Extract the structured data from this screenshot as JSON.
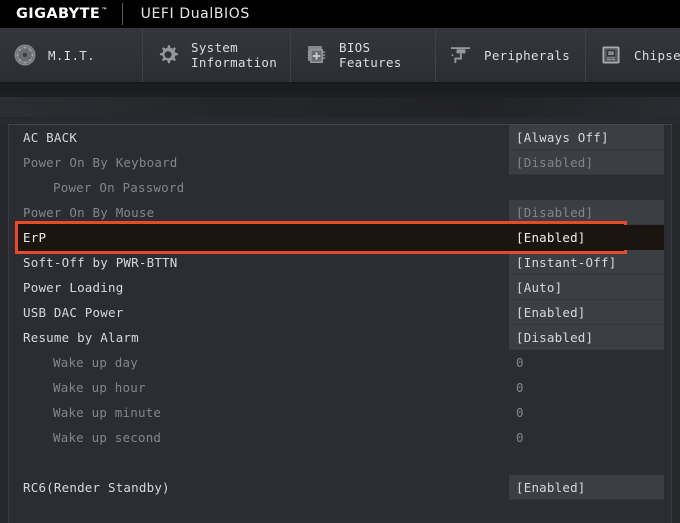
{
  "brand": {
    "logo": "GIGABYTE",
    "trademark": "™",
    "title": "UEFI DualBIOS"
  },
  "tabs": [
    {
      "label": "M.I.T.",
      "icon": "gauge-icon",
      "id": "mit"
    },
    {
      "label": "System\nInformation",
      "icon": "gear-icon",
      "id": "system-information"
    },
    {
      "label": "BIOS\nFeatures",
      "icon": "chip-plus-icon",
      "id": "bios-features"
    },
    {
      "label": "Peripherals",
      "icon": "connector-icon",
      "id": "peripherals"
    },
    {
      "label": "Chipset",
      "icon": "chipset-icon",
      "id": "chipset"
    }
  ],
  "settings": [
    {
      "label": "AC BACK",
      "value": "[Always Off]",
      "dim": false,
      "indent": false,
      "boxed": true,
      "highlight": false
    },
    {
      "label": "Power On By Keyboard",
      "value": "[Disabled]",
      "dim": true,
      "indent": false,
      "boxed": true,
      "highlight": false
    },
    {
      "label": "Power On Password",
      "value": "",
      "dim": true,
      "indent": true,
      "boxed": false,
      "highlight": false
    },
    {
      "label": "Power On By Mouse",
      "value": "[Disabled]",
      "dim": true,
      "indent": false,
      "boxed": true,
      "highlight": false
    },
    {
      "label": "ErP",
      "value": "[Enabled]",
      "dim": false,
      "indent": false,
      "boxed": true,
      "highlight": true
    },
    {
      "label": "Soft-Off by PWR-BTTN",
      "value": "[Instant-Off]",
      "dim": false,
      "indent": false,
      "boxed": true,
      "highlight": false
    },
    {
      "label": "Power Loading",
      "value": "[Auto]",
      "dim": false,
      "indent": false,
      "boxed": true,
      "highlight": false
    },
    {
      "label": "USB DAC Power",
      "value": "[Enabled]",
      "dim": false,
      "indent": false,
      "boxed": true,
      "highlight": false
    },
    {
      "label": "Resume by Alarm",
      "value": "[Disabled]",
      "dim": false,
      "indent": false,
      "boxed": true,
      "highlight": false
    },
    {
      "label": "Wake up day",
      "value": "0",
      "dim": true,
      "indent": true,
      "boxed": false,
      "highlight": false
    },
    {
      "label": "Wake up hour",
      "value": "0",
      "dim": true,
      "indent": true,
      "boxed": false,
      "highlight": false
    },
    {
      "label": "Wake up minute",
      "value": "0",
      "dim": true,
      "indent": true,
      "boxed": false,
      "highlight": false
    },
    {
      "label": "Wake up second",
      "value": "0",
      "dim": true,
      "indent": true,
      "boxed": false,
      "highlight": false
    },
    {
      "label": "",
      "value": "",
      "dim": false,
      "indent": false,
      "boxed": false,
      "highlight": false,
      "spacer": true
    },
    {
      "label": "RC6(Render Standby)",
      "value": "[Enabled]",
      "dim": false,
      "indent": false,
      "boxed": true,
      "highlight": false
    }
  ],
  "colors": {
    "highlight_border": "#e8492a",
    "panel_bg": "#2b2d32",
    "value_box_bg": "#3b3e43",
    "text": "#d6d8dc",
    "text_dim": "#82868c"
  }
}
